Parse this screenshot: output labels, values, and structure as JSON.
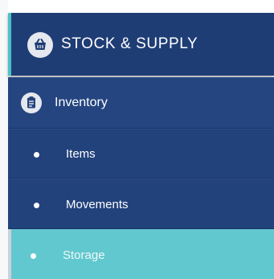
{
  "menu": {
    "section": {
      "title": "STOCK & SUPPLY",
      "icon": "basket-icon"
    },
    "group": {
      "label": "Inventory",
      "icon": "clipboard-list-icon"
    },
    "items": [
      {
        "label": "Items"
      },
      {
        "label": "Movements"
      },
      {
        "label": "Storage",
        "active": true
      }
    ]
  },
  "colors": {
    "navy": "#1f3d75",
    "row": "#22427c",
    "accent": "#4dc0c9",
    "active": "#62c8cf",
    "text": "#ffffff"
  }
}
